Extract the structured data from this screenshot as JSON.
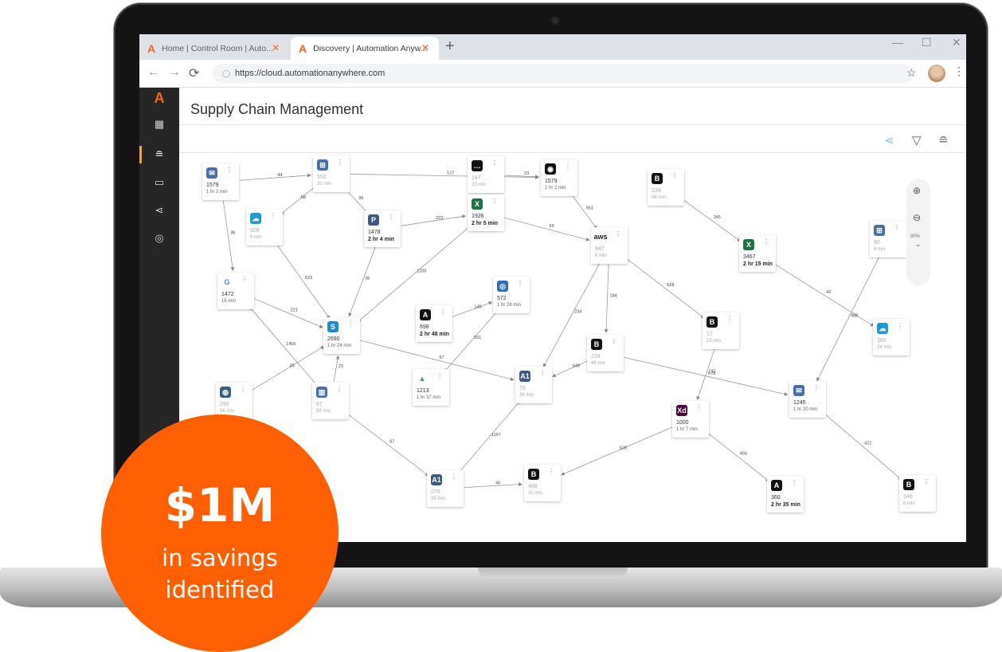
{
  "browser": {
    "tabs": [
      {
        "label": "Home | Control Room | Auto...",
        "active": false
      },
      {
        "label": "Discovery | Automation Anyw...",
        "active": true
      }
    ],
    "url": "https://cloud.automationanywhere.com"
  },
  "page": {
    "title": "Supply Chain Management"
  },
  "sidebar": {
    "items": [
      "dashboard-icon",
      "database-icon",
      "monitor-icon",
      "share-icon",
      "target-icon"
    ],
    "active_index": 1
  },
  "toolbar": {
    "icons": [
      "share-icon",
      "filter-icon",
      "database-icon"
    ]
  },
  "zoom": {
    "level": "80%"
  },
  "graph": {
    "nodes": [
      {
        "id": "n1",
        "icon": "mail-icon",
        "count": "1579",
        "duration": "1 hr 2 min",
        "style": "normal"
      },
      {
        "id": "n2",
        "icon": "windows-icon",
        "count": "550",
        "duration": "33 min",
        "style": "faded"
      },
      {
        "id": "n3",
        "icon": "chat-icon",
        "count": "147",
        "duration": "23 min",
        "style": "faded"
      },
      {
        "id": "n4",
        "icon": "chrome-icon",
        "count": "1579",
        "duration": "1 hr 2 min",
        "style": "normal"
      },
      {
        "id": "n5",
        "icon": "b-icon",
        "count": "234",
        "duration": "48 min",
        "style": "faded"
      },
      {
        "id": "n6",
        "icon": "salesforce-icon",
        "count": "926",
        "duration": "6 min",
        "style": "faded"
      },
      {
        "id": "n7",
        "icon": "pdf-icon",
        "count": "1478",
        "duration": "2 hr 4 min",
        "style": "bold"
      },
      {
        "id": "n8",
        "icon": "excel-icon",
        "count": "1926",
        "duration": "2 hr 5 min",
        "style": "bold"
      },
      {
        "id": "n9",
        "icon": "aws-icon",
        "count": "947",
        "duration": "6 min",
        "style": "faded"
      },
      {
        "id": "n10",
        "icon": "windows-icon",
        "count": "80",
        "duration": "8 min",
        "style": "faded"
      },
      {
        "id": "n11",
        "icon": "excel-icon",
        "count": "3467",
        "duration": "2 hr 15 min",
        "style": "bold"
      },
      {
        "id": "n12",
        "icon": "google-icon",
        "count": "1472",
        "duration": "16 min",
        "style": "normal"
      },
      {
        "id": "n13",
        "icon": "safari-icon",
        "count": "572",
        "duration": "1 hr 26 min",
        "style": "normal"
      },
      {
        "id": "n14",
        "icon": "angular-icon",
        "count": "698",
        "duration": "2 hr 48 min",
        "style": "bold"
      },
      {
        "id": "n15",
        "icon": "sap-icon",
        "count": "2690",
        "duration": "1 hr 24 min",
        "style": "normal"
      },
      {
        "id": "n16",
        "icon": "b-icon",
        "count": "17",
        "duration": "23 min",
        "style": "faded"
      },
      {
        "id": "n17",
        "icon": "salesforce-icon",
        "count": "386",
        "duration": "24 min",
        "style": "faded"
      },
      {
        "id": "n18",
        "icon": "b-icon",
        "count": "234",
        "duration": "48 min",
        "style": "faded"
      },
      {
        "id": "n19",
        "icon": "gdrive-icon",
        "count": "1213",
        "duration": "1 hr 37 min",
        "style": "normal"
      },
      {
        "id": "n20",
        "icon": "a1-icon",
        "count": "78",
        "duration": "34 min",
        "style": "faded"
      },
      {
        "id": "n21",
        "icon": "globe-icon",
        "count": "290",
        "duration": "56 min",
        "style": "faded"
      },
      {
        "id": "n22",
        "icon": "building-icon",
        "count": "67",
        "duration": "56 min",
        "style": "faded"
      },
      {
        "id": "n23",
        "icon": "mail-icon",
        "count": "1245",
        "duration": "1 hr 20 min",
        "style": "normal"
      },
      {
        "id": "n24",
        "icon": "xd-icon",
        "count": "1000",
        "duration": "1 hr 7 min",
        "style": "normal"
      },
      {
        "id": "n25",
        "icon": "a1-icon",
        "count": "278",
        "duration": "25 min",
        "style": "faded"
      },
      {
        "id": "n26",
        "icon": "b-icon",
        "count": "488",
        "duration": "32 min",
        "style": "faded"
      },
      {
        "id": "n27",
        "icon": "angular-icon",
        "count": "360",
        "duration": "2 hr 35 min",
        "style": "bold"
      },
      {
        "id": "n28",
        "icon": "b-icon",
        "count": "346",
        "duration": "8 min",
        "style": "faded"
      }
    ],
    "edges": [
      {
        "from": "n1",
        "to": "n2",
        "label": "44"
      },
      {
        "from": "n2",
        "to": "n4",
        "label": "127"
      },
      {
        "from": "n3",
        "to": "n4",
        "label": "23"
      },
      {
        "from": "n2",
        "to": "n6",
        "label": "68"
      },
      {
        "from": "n2",
        "to": "n7",
        "label": "96"
      },
      {
        "from": "n6",
        "to": "n15",
        "label": "523"
      },
      {
        "from": "n7",
        "to": "n8",
        "label": "223"
      },
      {
        "from": "n7",
        "to": "n15",
        "label": "78"
      },
      {
        "from": "n8",
        "to": "n15",
        "label": "1200"
      },
      {
        "from": "n8",
        "to": "n9",
        "label": "69"
      },
      {
        "from": "n4",
        "to": "n9",
        "label": "551"
      },
      {
        "from": "n9",
        "to": "n16",
        "label": "528"
      },
      {
        "from": "n9",
        "to": "n20",
        "label": "234"
      },
      {
        "from": "n9",
        "to": "n18",
        "label": "184"
      },
      {
        "from": "n1",
        "to": "n12",
        "label": "36"
      },
      {
        "from": "n12",
        "to": "n15",
        "label": "221"
      },
      {
        "from": "n14",
        "to": "n13",
        "label": "145"
      },
      {
        "from": "n13",
        "to": "n19",
        "label": "551"
      },
      {
        "from": "n15",
        "to": "n20",
        "label": "67"
      },
      {
        "from": "n22",
        "to": "n12",
        "label": "1456"
      },
      {
        "from": "n21",
        "to": "n15",
        "label": "45"
      },
      {
        "from": "n22",
        "to": "n15",
        "label": "23"
      },
      {
        "from": "n18",
        "to": "n20",
        "label": "649"
      },
      {
        "from": "n18",
        "to": "n23",
        "label": "678"
      },
      {
        "from": "n5",
        "to": "n11",
        "label": "345"
      },
      {
        "from": "n11",
        "to": "n17",
        "label": "42"
      },
      {
        "from": "n10",
        "to": "n23",
        "label": "458"
      },
      {
        "from": "n16",
        "to": "n24",
        "label": "742"
      },
      {
        "from": "n25",
        "to": "n20",
        "label": "1167"
      },
      {
        "from": "n25",
        "to": "n26",
        "label": "45"
      },
      {
        "from": "n24",
        "to": "n26",
        "label": "628"
      },
      {
        "from": "n24",
        "to": "n27",
        "label": "456"
      },
      {
        "from": "n23",
        "to": "n28",
        "label": "421"
      },
      {
        "from": "n22",
        "to": "n25",
        "label": "67"
      }
    ]
  },
  "promo": {
    "amount": "$1M",
    "line1": "in savings",
    "line2": "identified"
  },
  "colors": {
    "accent": "#ff5f00",
    "sidebar": "#262626",
    "active_marker": "#f5a623"
  }
}
